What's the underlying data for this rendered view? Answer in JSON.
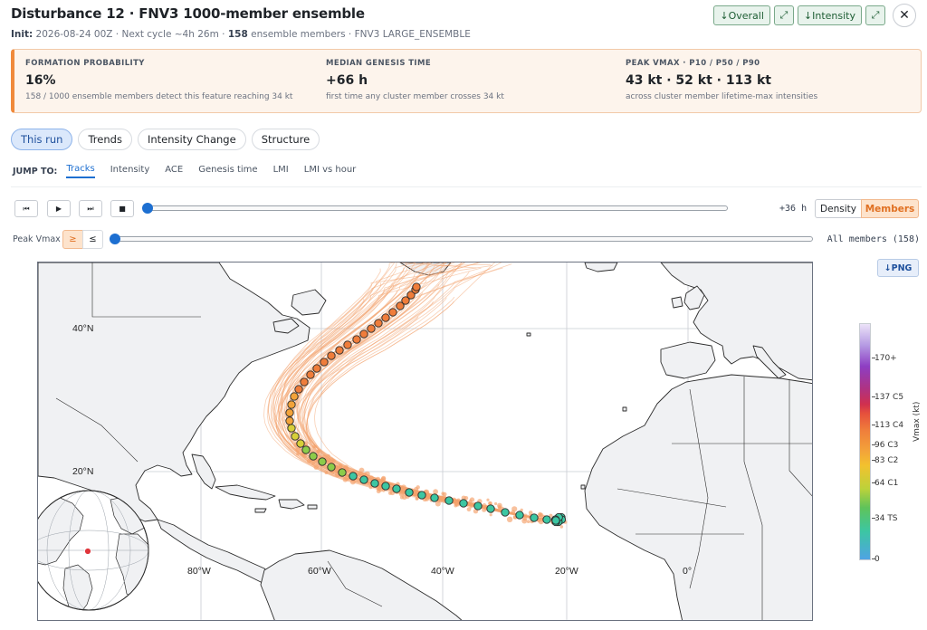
{
  "header": {
    "title": "Disturbance 12 · FNV3 1000-member ensemble",
    "init_label": "Init:",
    "init_time": "2026-08-24 00Z",
    "sep1": " · ",
    "next_cycle": "Next cycle ~4h 26m",
    "sep2": " · ",
    "member_count": "158",
    "members_suffix": " ensemble members",
    "sep3": " · ",
    "ensemble_name": "FNV3 LARGE_ENSEMBLE",
    "actions": {
      "overall_label": "↓Overall",
      "expand_icon": "⤢",
      "intensity_label": "↓Intensity",
      "close_icon": "✕"
    }
  },
  "summary": {
    "formation": {
      "label": "FORMATION PROBABILITY",
      "value": "16%",
      "note": "158 / 1000 ensemble members detect this feature reaching 34 kt"
    },
    "genesis": {
      "label": "MEDIAN GENESIS TIME",
      "value": "+66 h",
      "note": "first time any cluster member crosses 34 kt"
    },
    "peak": {
      "label": "PEAK VMAX · P10 / P50 / P90",
      "value": "43 kt · 52 kt · 113 kt",
      "note": "across cluster member lifetime-max intensities"
    }
  },
  "tabs": [
    "This run",
    "Trends",
    "Intensity Change",
    "Structure"
  ],
  "jump": {
    "label": "JUMP TO:",
    "links": [
      "Tracks",
      "Intensity",
      "ACE",
      "Genesis time",
      "LMI",
      "LMI vs hour"
    ]
  },
  "playback": {
    "first_icon": "⏮",
    "play_icon": "▶",
    "last_icon": "⏭",
    "stop_icon": "■",
    "hour_readout": "+36 h",
    "time_progress": 0.0,
    "view_modes": [
      "Density",
      "Members"
    ],
    "active_view": "Members"
  },
  "filter": {
    "label": "Peak Vmax",
    "ge_symbol": "≥",
    "le_symbol": "≤",
    "readout": "All members (158)",
    "threshold_progress": 0.0
  },
  "map": {
    "png_label": "↓PNG",
    "lat_labels": [
      "40°N",
      "20°N"
    ],
    "lon_labels": [
      "80°W",
      "60°W",
      "40°W",
      "20°W",
      "0°"
    ],
    "colorbar_title": "Vmax (kt)",
    "colorbar_labels": [
      "170+",
      "137 C5",
      "113 C4",
      "96 C3",
      "83 C2",
      "64 C1",
      "34 TS",
      "0"
    ],
    "colors": {
      "ensemble_tracks": "#f4a26b",
      "ts": "#3cc6a2",
      "cat1": "#f3a33a",
      "cat2": "#ef7d3b",
      "land": "#f0f1f3",
      "coast": "#2b2b2b"
    }
  }
}
